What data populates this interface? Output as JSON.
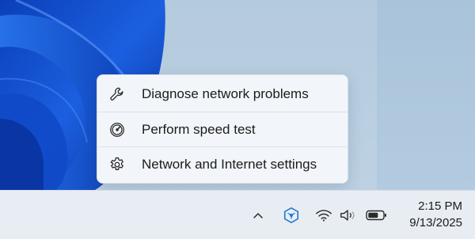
{
  "flyout": {
    "items": [
      {
        "label": "Diagnose network problems",
        "icon": "wrench-icon"
      },
      {
        "label": "Perform speed test",
        "icon": "speedometer-icon"
      },
      {
        "label": "Network and Internet settings",
        "icon": "gear-icon"
      }
    ]
  },
  "tray": {
    "icons": [
      "chevron-up-icon",
      "network-app-icon",
      "wifi-icon",
      "speaker-icon",
      "battery-icon"
    ]
  },
  "clock": {
    "time": "2:15 PM",
    "date": "9/13/2025"
  },
  "colors": {
    "accent": "#2a78c8",
    "wallpaper_blue": "#1a56d8"
  }
}
